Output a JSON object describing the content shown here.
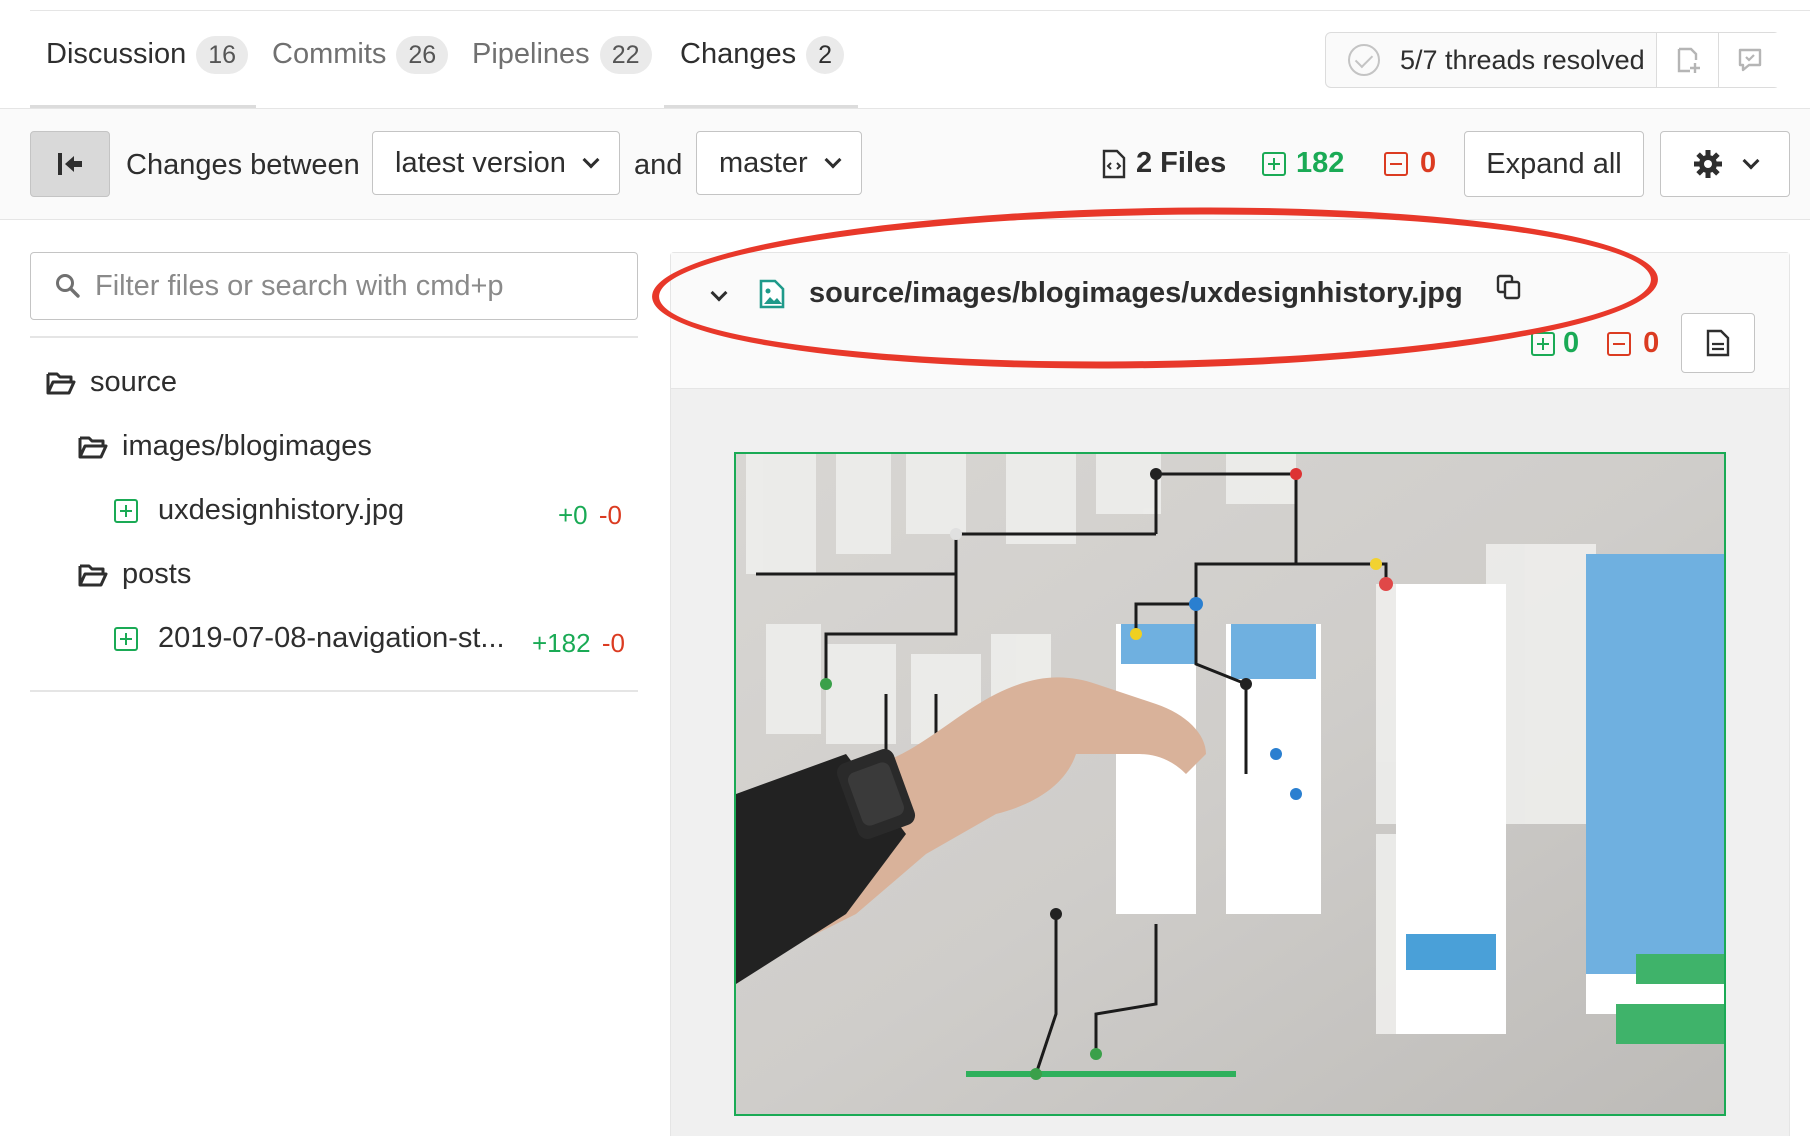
{
  "tabs": [
    {
      "label": "Discussion",
      "count": "16"
    },
    {
      "label": "Commits",
      "count": "26"
    },
    {
      "label": "Pipelines",
      "count": "22"
    },
    {
      "label": "Changes",
      "count": "2"
    }
  ],
  "threads": {
    "label": "5/7 threads resolved"
  },
  "toolbar": {
    "changes_between": "Changes between",
    "from_version": "latest version",
    "and": "and",
    "to_version": "master",
    "files_count": "2 Files",
    "additions": "182",
    "deletions": "0",
    "expand_all": "Expand all"
  },
  "sidebar": {
    "filter_placeholder": "Filter files or search with cmd+p",
    "tree": [
      {
        "type": "folder",
        "name": "source"
      },
      {
        "type": "folder",
        "name": "images/blogimages"
      },
      {
        "type": "file",
        "name": "uxdesignhistory.jpg",
        "plus": "+0",
        "minus": "-0"
      },
      {
        "type": "folder",
        "name": "posts"
      },
      {
        "type": "file",
        "name": "2019-07-08-navigation-st...",
        "plus": "+182",
        "minus": "-0"
      }
    ]
  },
  "diff": {
    "file_path": "source/images/blogimages/uxdesignhistory.jpg",
    "added": "0",
    "removed": "0"
  },
  "colors": {
    "added": "#1aaa55",
    "removed": "#db3b21",
    "annotation": "#e8382a"
  }
}
